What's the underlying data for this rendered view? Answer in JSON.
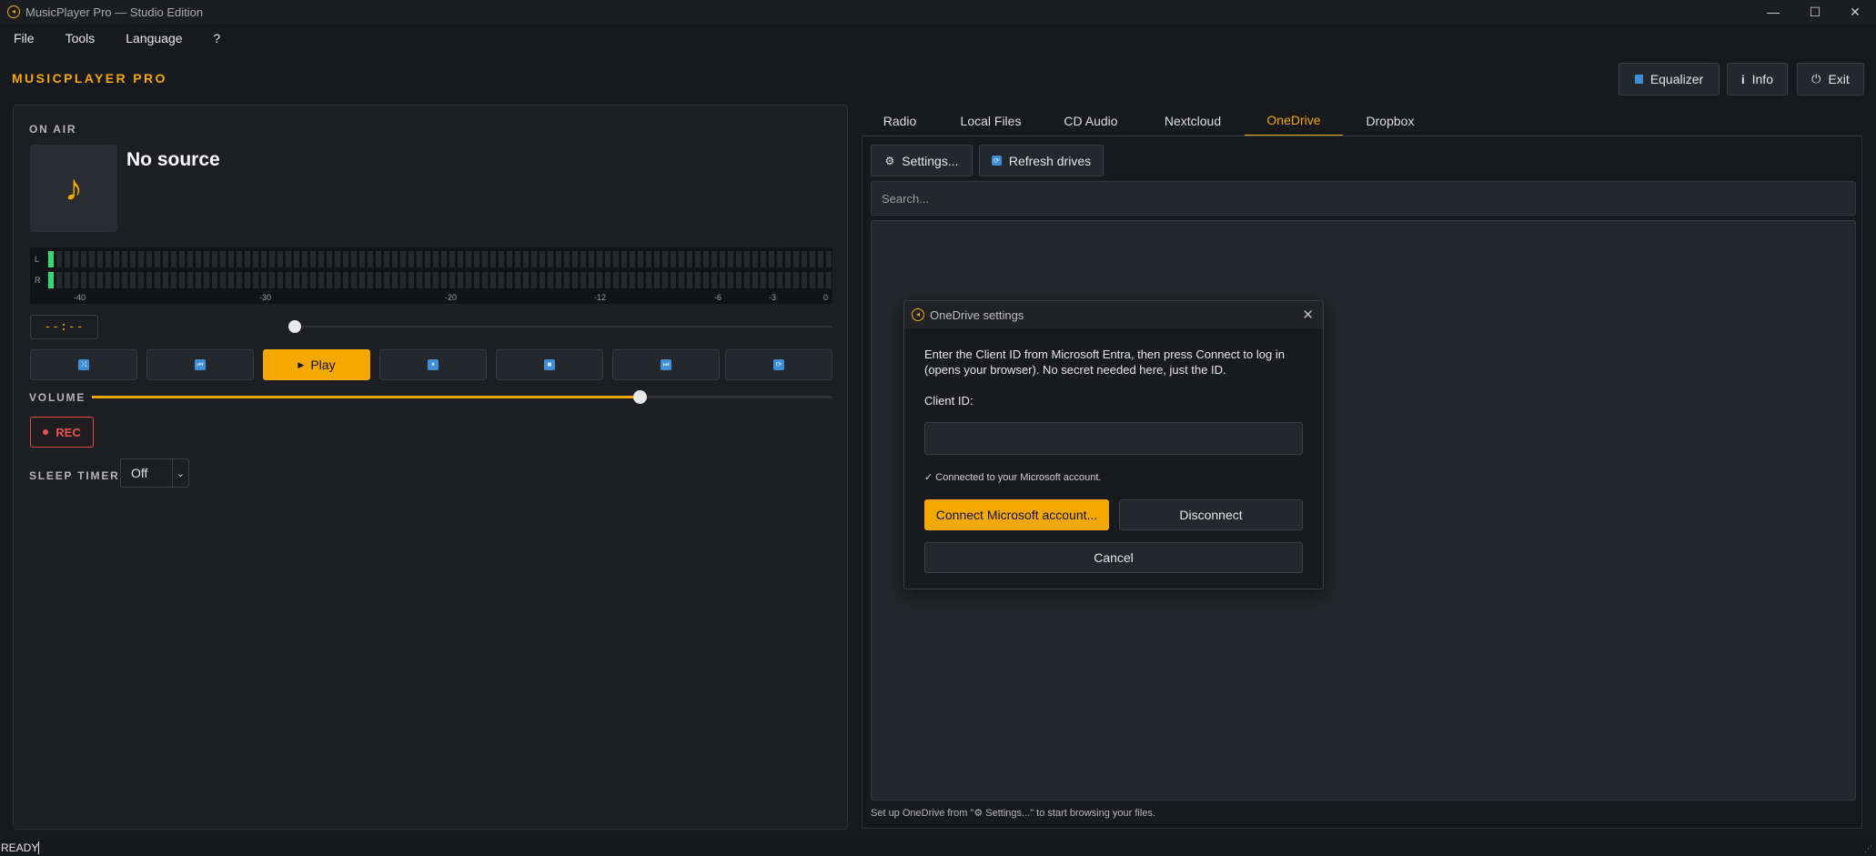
{
  "window": {
    "title": "MusicPlayer Pro — Studio Edition",
    "minimize": "—",
    "maximize": "☐",
    "close": "✕"
  },
  "menu": [
    "File",
    "Tools",
    "Language",
    "?"
  ],
  "header": {
    "brand": "MUSICPLAYER PRO",
    "equalizer_label": "Equalizer",
    "info_label": "Info",
    "exit_label": "Exit"
  },
  "player": {
    "on_air_label": "ON AIR",
    "source_title": "No source",
    "time_display": "--:--",
    "vu": {
      "left_label": "L",
      "right_label": "R",
      "scale": [
        "-40",
        "-30",
        "-20",
        "-12",
        "-6",
        "-3",
        "0"
      ]
    },
    "controls": {
      "shuffle_icon": "shuffle-icon",
      "previous_icon": "previous-icon",
      "play_label": "Play",
      "pause_icon": "pause-icon",
      "stop_icon": "stop-icon",
      "next_icon": "next-icon",
      "repeat_icon": "repeat-icon"
    },
    "seek_position": 0,
    "volume_label": "VOLUME",
    "volume_fraction": 0.74,
    "rec_label": "REC",
    "sleep_timer_label": "SLEEP TIMER",
    "sleep_timer_value": "Off"
  },
  "tabs": [
    {
      "label": "Radio",
      "active": false
    },
    {
      "label": "Local Files",
      "active": false
    },
    {
      "label": "CD Audio",
      "active": false
    },
    {
      "label": "Nextcloud",
      "active": false
    },
    {
      "label": "OneDrive",
      "active": true
    },
    {
      "label": "Dropbox",
      "active": false
    }
  ],
  "onedrive": {
    "settings_label": "Settings...",
    "refresh_label": "Refresh drives",
    "search_placeholder": "Search...",
    "hint_prefix": "Set up OneDrive from \"",
    "hint_settings": "Settings...",
    "hint_suffix": "\" to start browsing your files."
  },
  "dialog": {
    "title": "OneDrive settings",
    "instructions": "Enter the Client ID from Microsoft Entra, then press Connect to log in (opens your browser). No secret needed here, just the ID.",
    "client_id_label": "Client ID:",
    "client_id_value": "",
    "status": "✓ Connected to your Microsoft account.",
    "connect_label": "Connect Microsoft account...",
    "disconnect_label": "Disconnect",
    "cancel_label": "Cancel"
  },
  "statusbar": {
    "text": "READY"
  },
  "colors": {
    "accent": "#f5a800",
    "meter_on": "#2fdc73",
    "rec": "#e85454",
    "icon_blue": "#3f8fd6"
  }
}
